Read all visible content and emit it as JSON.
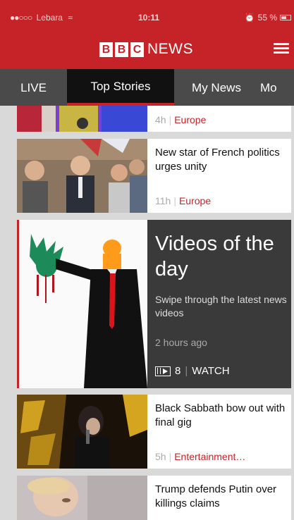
{
  "status": {
    "carrier": "Lebara",
    "time": "10:11",
    "battery": "55 %"
  },
  "header": {
    "logo_letters": [
      "B",
      "B",
      "C"
    ],
    "logo_word": "NEWS"
  },
  "tabs": [
    {
      "label": "LIVE"
    },
    {
      "label": "Top Stories"
    },
    {
      "label": "My News"
    },
    {
      "label": "Mo"
    }
  ],
  "feed": {
    "europe_top": {
      "age": "4h",
      "category": "Europe"
    },
    "macron": {
      "headline": "New star of French politics urges unity",
      "age": "11h",
      "category": "Europe"
    },
    "videos": {
      "title": "Videos of the day",
      "subtitle": "Swipe through the latest news videos",
      "age": "2 hours ago",
      "count": "8",
      "watch": "WATCH"
    },
    "sabbath": {
      "headline": "Black Sabbath bow out with final gig",
      "age": "5h",
      "category": "Entertainment…"
    },
    "trump": {
      "headline": "Trump defends Putin over killings claims"
    }
  },
  "colors": {
    "brand": "#c62328",
    "tab_bar": "#4a4a4a",
    "tab_active": "#111111",
    "video_card": "#3a3a3a"
  }
}
